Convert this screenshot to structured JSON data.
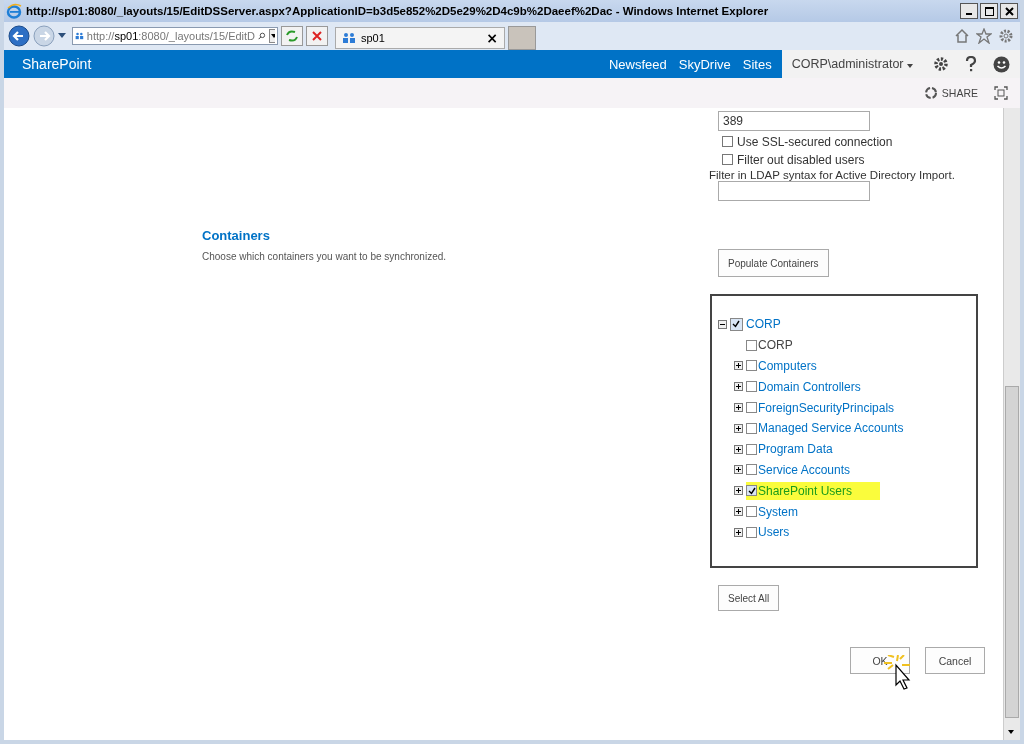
{
  "window": {
    "title": "http://sp01:8080/_layouts/15/EditDSServer.aspx?ApplicationID=b3d5e852%2D5e29%2D4c9b%2Daeef%2Dac - Windows Internet Explorer"
  },
  "browser": {
    "address_prefix": "http://",
    "address_host": "sp01",
    "address_rest": ":8080/_layouts/15/EditD",
    "tab_title": "sp01",
    "tab_close": "×"
  },
  "suite_bar": {
    "brand": "SharePoint",
    "links": [
      "Newsfeed",
      "SkyDrive",
      "Sites"
    ],
    "user": "CORP\\administrator"
  },
  "ribbon": {
    "share": "SHARE"
  },
  "connection": {
    "port": "389",
    "options": [
      {
        "label": "Use SSL-secured connection",
        "checked": false
      },
      {
        "label": "Filter out disabled users",
        "checked": false
      }
    ],
    "filter_label": "Filter in LDAP syntax for Active Directory Import."
  },
  "containers": {
    "title": "Containers",
    "description": "Choose which containers you want to be synchronized.",
    "populate_button": "Populate Containers",
    "tree": [
      {
        "label": "CORP",
        "checked": true,
        "expanded": true,
        "children": [
          {
            "label": "CORP",
            "checked": false,
            "kind": "leaf",
            "highlighted": false
          },
          {
            "label": "Computers",
            "checked": false,
            "kind": "folder",
            "highlighted": false
          },
          {
            "label": "Domain Controllers",
            "checked": false,
            "kind": "folder",
            "highlighted": false
          },
          {
            "label": "ForeignSecurityPrincipals",
            "checked": false,
            "kind": "folder",
            "highlighted": false
          },
          {
            "label": "Managed Service Accounts",
            "checked": false,
            "kind": "folder",
            "highlighted": false
          },
          {
            "label": "Program Data",
            "checked": false,
            "kind": "folder",
            "highlighted": false
          },
          {
            "label": "Service Accounts",
            "checked": false,
            "kind": "folder",
            "highlighted": false
          },
          {
            "label": "SharePoint Users",
            "checked": true,
            "kind": "folder",
            "highlighted": true
          },
          {
            "label": "System",
            "checked": false,
            "kind": "folder",
            "highlighted": false
          },
          {
            "label": "Users",
            "checked": false,
            "kind": "folder",
            "highlighted": false
          }
        ]
      }
    ],
    "select_all_button": "Select All"
  },
  "buttons": [
    "OK",
    "Cancel"
  ]
}
